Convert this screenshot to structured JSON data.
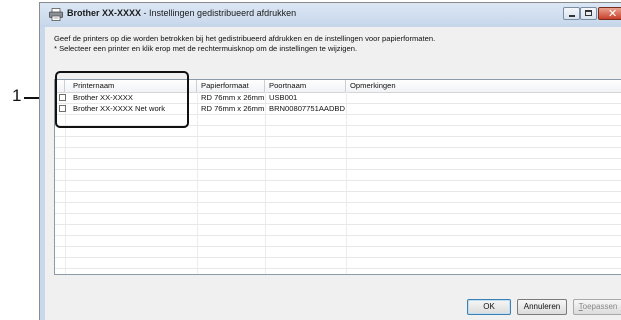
{
  "callout": {
    "number": "1"
  },
  "window": {
    "title_bold": "Brother XX-XXXX",
    "title_rest": " - Instellingen gedistribueerd afdrukken",
    "icons": [
      "printer-icon",
      "minimize-icon",
      "maximize-icon",
      "close-icon"
    ]
  },
  "instructions": {
    "line1": "Geef de printers op die worden betrokken bij het gedistribueerd afdrukken en de instellingen voor papierformaten.",
    "line2": "* Selecteer een printer en klik erop met de rechtermuisknop om de instellingen te wijzigen."
  },
  "table": {
    "columns": [
      "Printernaam",
      "Papierformaat",
      "Poortnaam",
      "Opmerkingen"
    ],
    "rows": [
      {
        "printer": "Brother XX-XXXX",
        "paper": "RD 76mm x 26mm",
        "port": "USB001",
        "notes": "",
        "checked": false
      },
      {
        "printer": "Brother XX-XXXX Net work",
        "paper": "RD 76mm x 26mm",
        "port": "BRN00807751AADBD",
        "notes": "",
        "checked": false
      }
    ]
  },
  "buttons": {
    "ok": "OK",
    "cancel": "Annuleren",
    "apply_mnemonic": "T",
    "apply_rest": "oepassen"
  }
}
